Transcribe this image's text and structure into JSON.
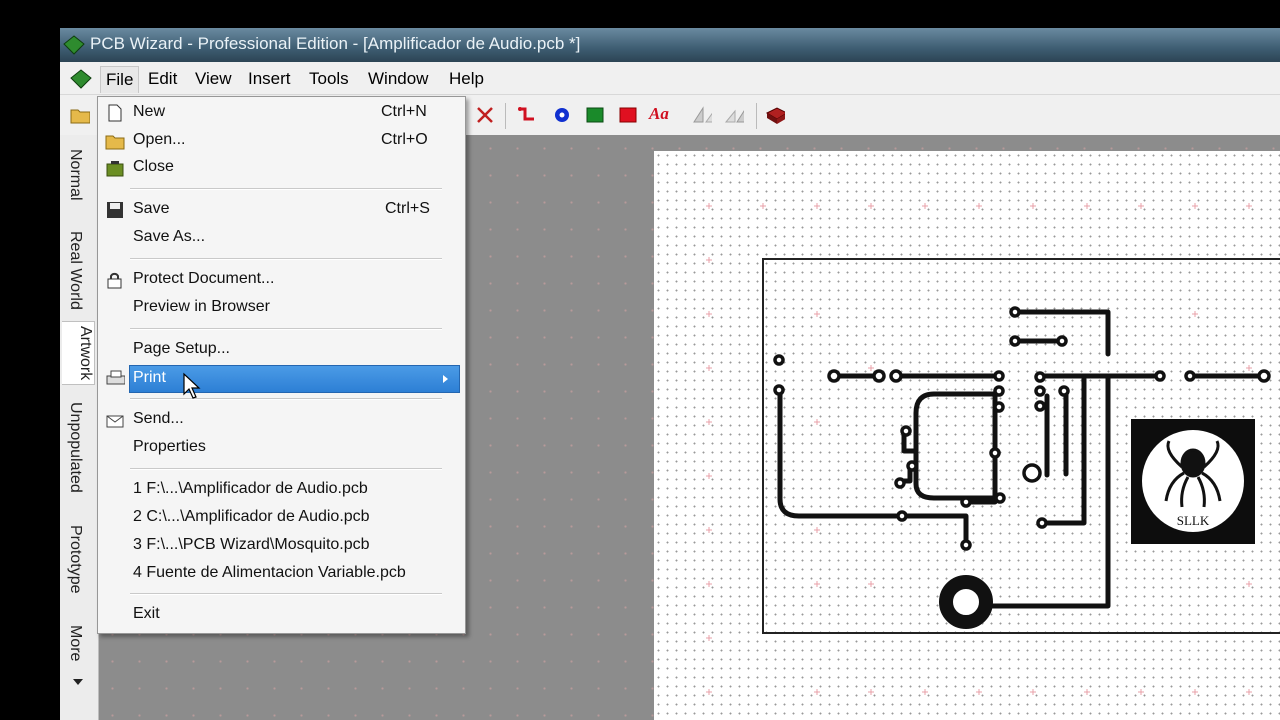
{
  "window": {
    "title": "PCB Wizard - Professional Edition - [Amplificador de Audio.pcb *]"
  },
  "menubar": {
    "items": [
      "File",
      "Edit",
      "View",
      "Insert",
      "Tools",
      "Window",
      "Help"
    ]
  },
  "side_tabs": [
    "Normal",
    "Real World",
    "Artwork",
    "Unpopulated",
    "Prototype",
    "More"
  ],
  "file_menu": {
    "new": {
      "label": "New",
      "shortcut": "Ctrl+N"
    },
    "open": {
      "label": "Open...",
      "shortcut": "Ctrl+O"
    },
    "close": {
      "label": "Close"
    },
    "save": {
      "label": "Save",
      "shortcut": "Ctrl+S"
    },
    "save_as": {
      "label": "Save As..."
    },
    "protect": {
      "label": "Protect Document..."
    },
    "preview": {
      "label": "Preview in Browser"
    },
    "page_setup": {
      "label": "Page Setup..."
    },
    "print": {
      "label": "Print"
    },
    "send": {
      "label": "Send..."
    },
    "properties": {
      "label": "Properties"
    },
    "recent": [
      "1 F:\\...\\Amplificador de Audio.pcb",
      "2 C:\\...\\Amplificador de Audio.pcb",
      "3 F:\\...\\PCB Wizard\\Mosquito.pcb",
      "4 Fuente de Alimentacion Variable.pcb"
    ],
    "exit": {
      "label": "Exit"
    }
  },
  "toolbar": {
    "text_tool_label": "Aa"
  },
  "logo": {
    "text": "SLLK"
  }
}
